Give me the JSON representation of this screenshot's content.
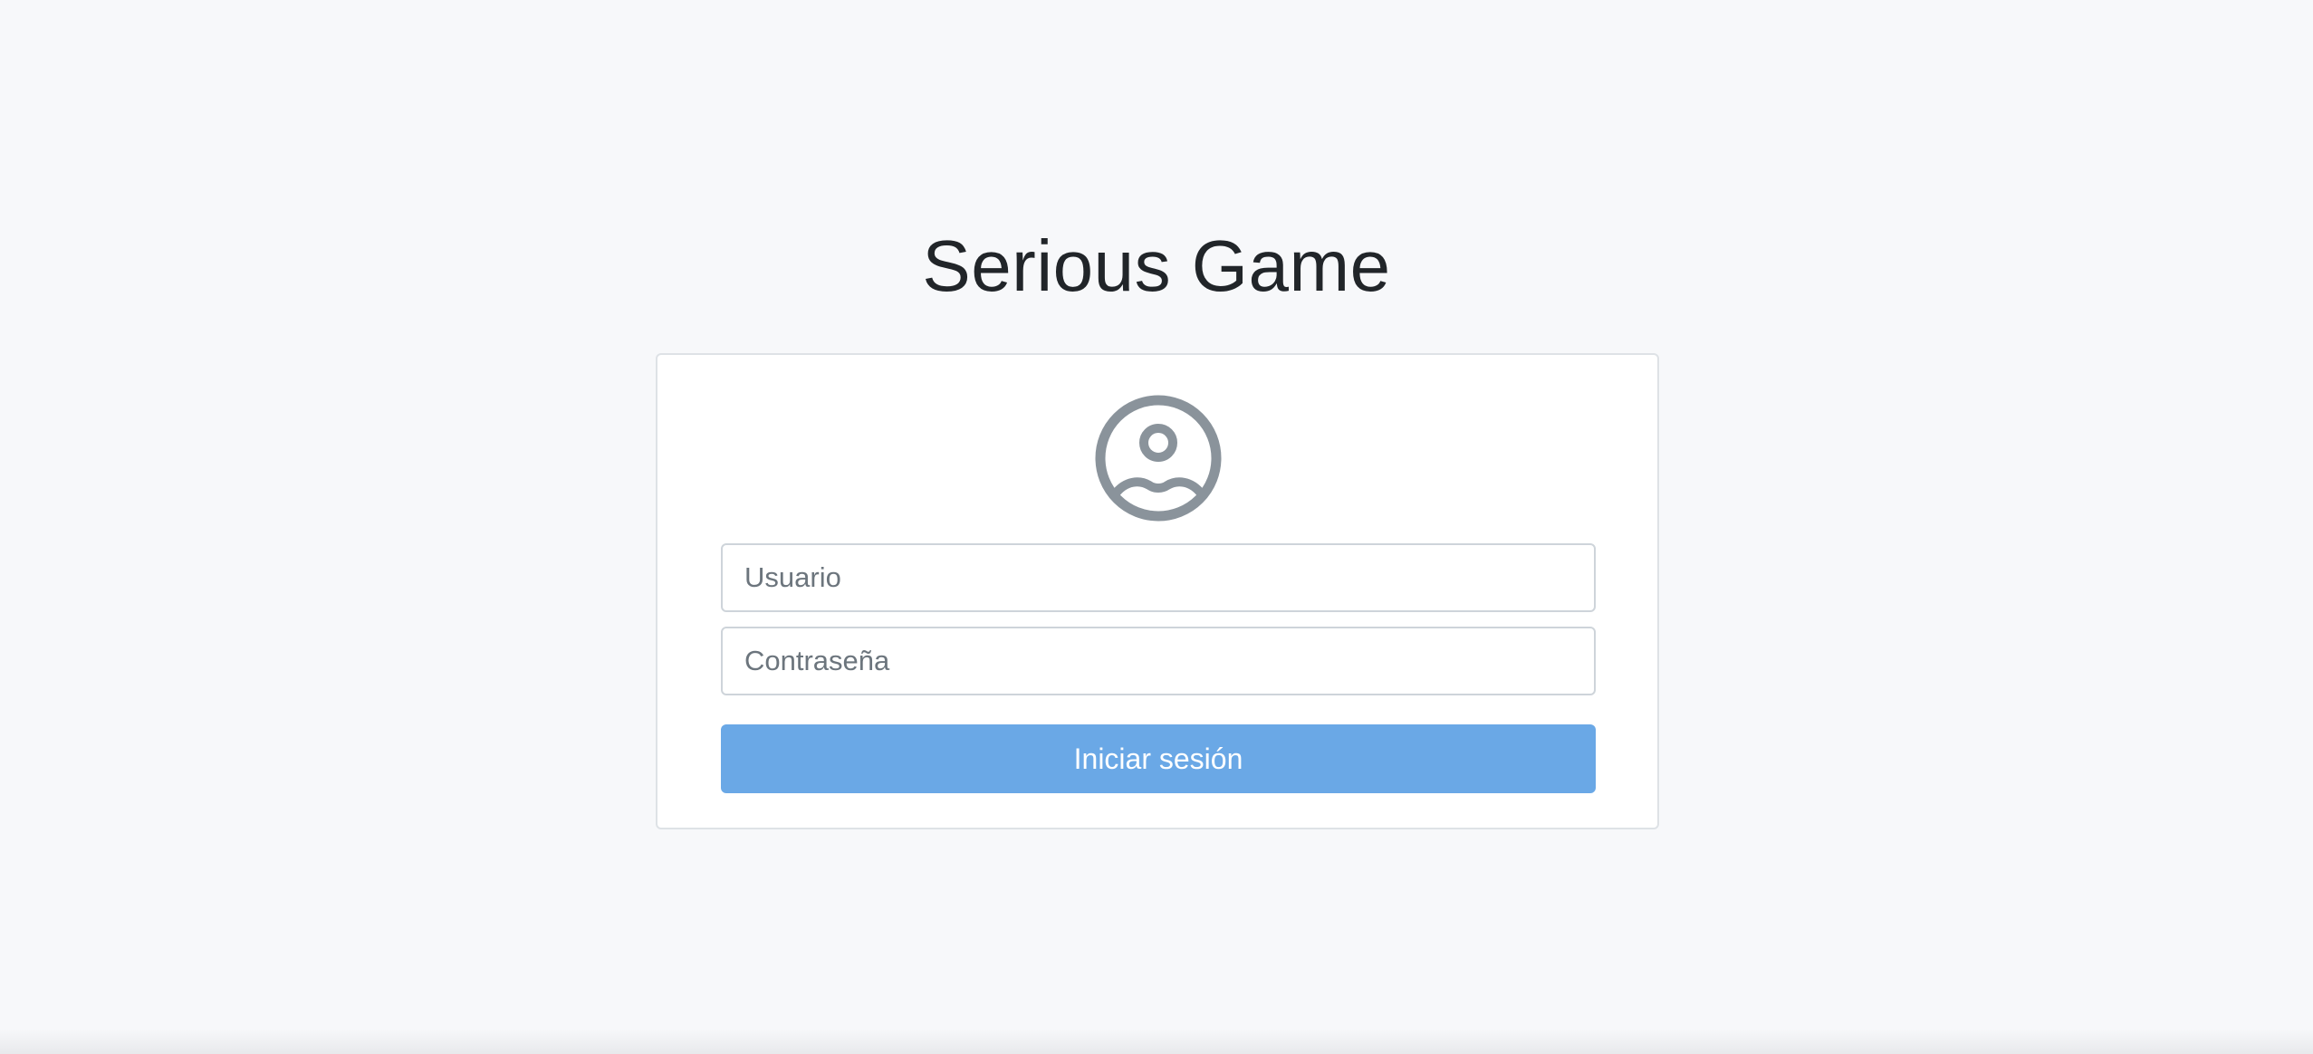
{
  "app": {
    "title": "Serious Game"
  },
  "login_form": {
    "avatar_icon": "user-circle-icon",
    "username": {
      "value": "",
      "placeholder": "Usuario"
    },
    "password": {
      "value": "",
      "placeholder": "Contraseña"
    },
    "submit_label": "Iniciar sesión"
  },
  "colors": {
    "background": "#f7f8fa",
    "card_border": "#dee2e6",
    "icon": "#8a939b",
    "button": "#6aa8e6",
    "button_text": "#ffffff",
    "title_text": "#212529"
  }
}
